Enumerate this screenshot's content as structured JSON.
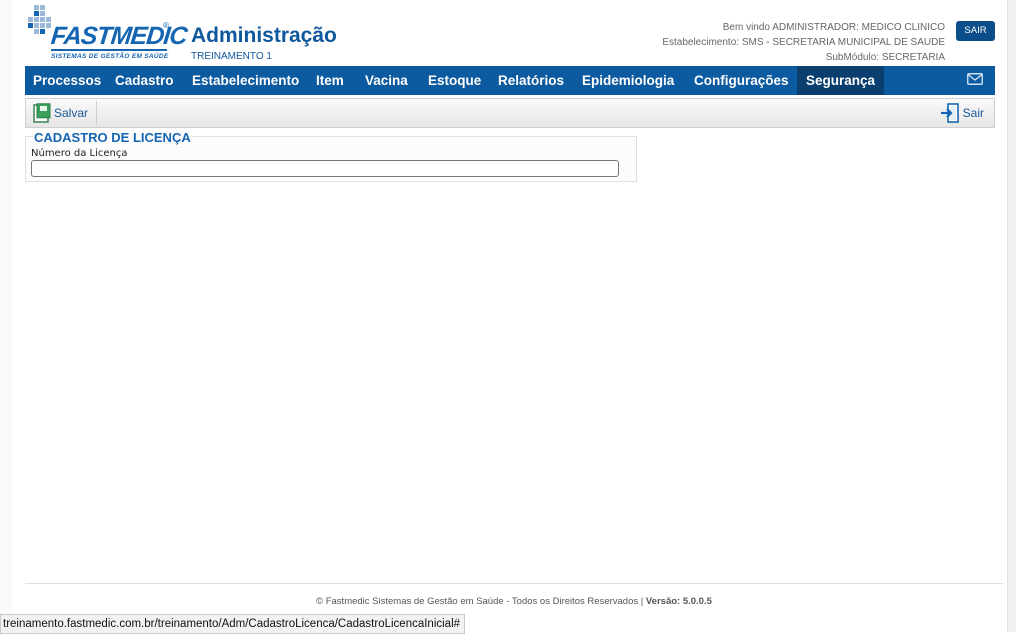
{
  "header": {
    "logo_text": "FASTMEDIC",
    "logo_subtitle": "SISTEMAS DE GESTÃO EM SAÚDE",
    "title": "Administração",
    "subtitle": "TREINAMENTO 1",
    "welcome": "Bem vindo ADMINISTRADOR: MEDICO CLINICO",
    "establishment": "Estabelecimento: SMS - SECRETARIA MUNICIPAL DE SAUDE",
    "submodule": "SubMódulo: SECRETARIA",
    "logout_label": "SAIR"
  },
  "nav": {
    "items": [
      {
        "label": "Processos"
      },
      {
        "label": "Cadastro"
      },
      {
        "label": "Estabelecimento"
      },
      {
        "label": "Item"
      },
      {
        "label": "Vacina"
      },
      {
        "label": "Estoque"
      },
      {
        "label": "Relatórios"
      },
      {
        "label": "Epidemiologia"
      },
      {
        "label": "Configurações"
      },
      {
        "label": "Segurança"
      }
    ],
    "active": "Segurança",
    "mail_icon": "envelope-icon"
  },
  "toolbar": {
    "save_label": "Salvar",
    "save_icon": "save-icon",
    "exit_label": "Sair",
    "exit_icon": "exit-icon"
  },
  "form": {
    "title": "CADASTRO DE LICENÇA",
    "field_label": "Número da Licença",
    "field_value": ""
  },
  "footer": {
    "text": "© Fastmedic Sistemas de Gestão em Saúde - Todos os Direitos Reservados | ",
    "version": "Versão: 5.0.0.5"
  },
  "statusbar": {
    "url": "treinamento.fastmedic.com.br/treinamento/Adm/CadastroLicenca/CadastroLicencaInicial#"
  },
  "colors": {
    "brand": "#0c5aa0",
    "nav_active": "#0a3e6e",
    "title": "#10589e"
  }
}
